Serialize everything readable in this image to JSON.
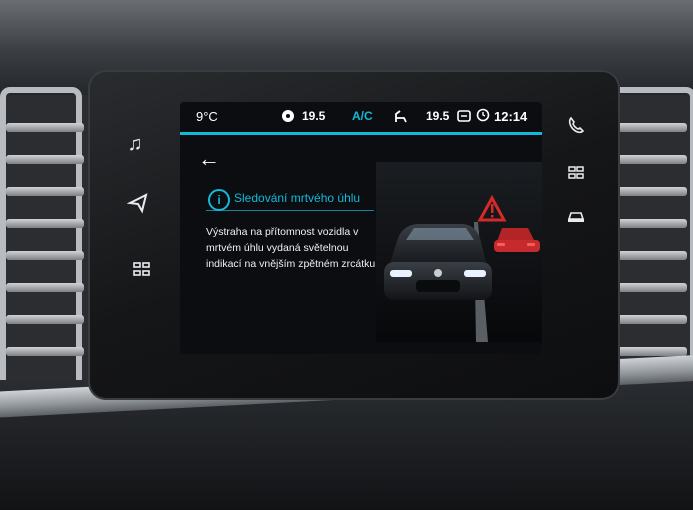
{
  "status_bar": {
    "temp_outside": "9°C",
    "left_temp": "19.5",
    "ac_label": "A/C",
    "right_temp": "19.5",
    "clock": "12:14"
  },
  "page": {
    "title": "Sledování mrtvého úhlu",
    "description": "Výstraha na přítomnost vozidla v mrtvém úhlu vydaná světelnou indikací na vnějším zpětném zrcátku."
  },
  "colors": {
    "accent": "#12b9d8",
    "warning": "#d42a2a"
  },
  "icons": {
    "left_side": [
      "music-note-icon",
      "navigation-icon",
      "car-settings-icon"
    ],
    "right_side": [
      "phone-icon",
      "apps-grid-icon",
      "car-icon"
    ],
    "status": [
      "fan-icon",
      "seat-heat-icon",
      "clock-icon"
    ]
  }
}
